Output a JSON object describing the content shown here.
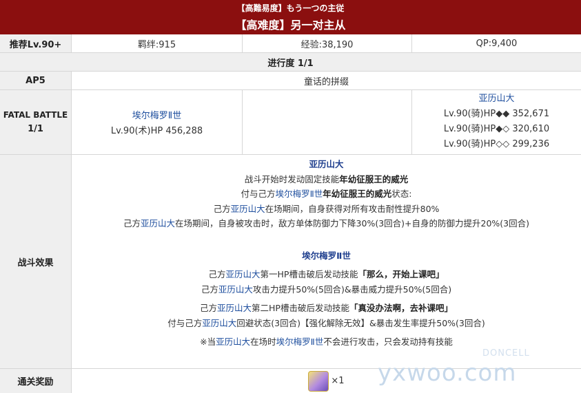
{
  "header": {
    "subtitle": "【高難易度】もう一つの主従",
    "title": "【高难度】另一对主从"
  },
  "info_row": {
    "recommend": "推荐Lv.90+",
    "bond": "羁绊:915",
    "exp": "经验:38,190",
    "qp": "QP:9,400"
  },
  "progress": "进行度 1/1",
  "ap_row": {
    "ap": "AP5",
    "name": "童话的拼缀"
  },
  "battle": {
    "label_1": "FATAL BATTLE",
    "label_2": "1/1",
    "enemy1_name": "埃尔梅罗Ⅱ世",
    "enemy1_stats": "Lv.90(术)HP 456,288",
    "enemy2_name": "亚历山大",
    "enemy2_hp1": "Lv.90(骑)HP◆◆ 352,671",
    "enemy2_hp2": "Lv.90(骑)HP◆◇ 320,610",
    "enemy2_hp3": "Lv.90(骑)HP◇◇ 299,236"
  },
  "effects": {
    "label": "战斗效果",
    "alex_title": "亚历山大",
    "a1_pre": "战斗开始时发动固定技能",
    "a1_skill": "年幼征服王的威光",
    "a2_pre": "付与己方",
    "a2_link": "埃尔梅罗Ⅱ世",
    "a2_skill": "年幼征服王的威光",
    "a2_post": "状态:",
    "a3_pre": "己方",
    "a3_link": "亚历山大",
    "a3_post": "在场期间，自身获得对所有攻击耐性提升80%",
    "a4_pre": "己方",
    "a4_link": "亚历山大",
    "a4_post": "在场期间，自身被攻击时，敌方单体防御力下降30%(3回合)+自身的防御力提升20%(3回合)",
    "el_title": "埃尔梅罗Ⅱ世",
    "e1_pre": "己方",
    "e1_link": "亚历山大",
    "e1_mid": "第一HP槽击破后发动技能",
    "e1_skill": "「那么，开始上课吧」",
    "e2_pre": "己方",
    "e2_link": "亚历山大",
    "e2_post": "攻击力提升50%(5回合)&暴击威力提升50%(5回合)",
    "e3_pre": "己方",
    "e3_link": "亚历山大",
    "e3_mid": "第二HP槽击破后发动技能",
    "e3_skill": "「真没办法啊，去补课吧」",
    "e4_pre": "付与己方",
    "e4_link": "亚历山大",
    "e4_post": "回避状态(3回合)【强化解除无效】&暴击发生率提升50%(3回合)",
    "n_pre": "※当",
    "n_link1": "亚历山大",
    "n_mid": "在场时",
    "n_link2": "埃尔梅罗Ⅱ世",
    "n_post": "不会进行攻击，只会发动持有技能"
  },
  "reward": {
    "label": "通关奖励",
    "count": "×1",
    "icon": "item-card-icon"
  },
  "watermark": {
    "text": "yxwoo.com",
    "small": "DONCELL"
  },
  "colors": {
    "header_bg": "#8b0f0f",
    "link": "#1f4f9e",
    "label_bg": "#efefef",
    "border": "#d6d6d6"
  }
}
